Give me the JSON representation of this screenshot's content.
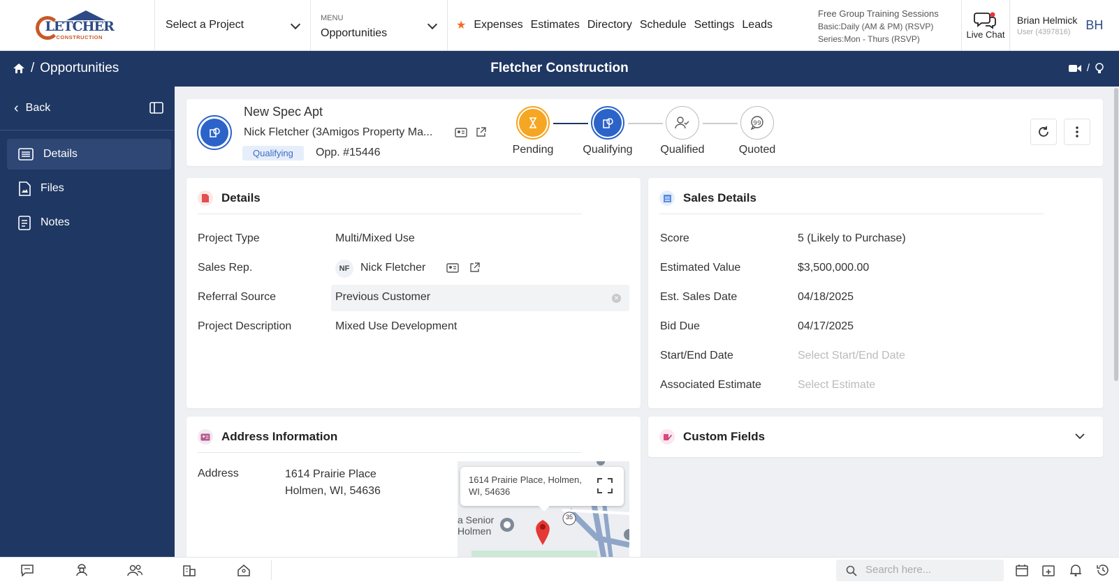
{
  "topbar": {
    "logo_main": "LETCHER",
    "logo_sub": "CONSTRUCTION",
    "project_select": "Select a Project",
    "menu_label": "MENU",
    "menu_value": "Opportunities",
    "nav": [
      "Expenses",
      "Estimates",
      "Directory",
      "Schedule",
      "Settings",
      "Leads"
    ],
    "training_title": "Free Group Training Sessions",
    "training_line1": "Basic:Daily (AM & PM) (RSVP)",
    "training_line2": "Series:Mon - Thurs (RSVP)",
    "live_chat": "Live Chat",
    "user_name": "Brian Helmick",
    "user_sub": "User (4397816)",
    "user_initials": "BH"
  },
  "titlebar": {
    "separator": "/",
    "breadcrumb": "Opportunities",
    "company": "Fletcher Construction"
  },
  "sidebar": {
    "back": "Back",
    "items": [
      {
        "label": "Details"
      },
      {
        "label": "Files"
      },
      {
        "label": "Notes"
      }
    ]
  },
  "header": {
    "title": "New Spec Apt",
    "contact": "Nick Fletcher (3Amigos Property Ma...",
    "status_badge": "Qualifying",
    "opp_number": "Opp. #15446",
    "stages": [
      "Pending",
      "Qualifying",
      "Qualified",
      "Quoted"
    ]
  },
  "details": {
    "title": "Details",
    "project_type_label": "Project Type",
    "project_type": "Multi/Mixed Use",
    "sales_rep_label": "Sales Rep.",
    "sales_rep_initials": "NF",
    "sales_rep": "Nick Fletcher",
    "referral_label": "Referral Source",
    "referral": "Previous Customer",
    "description_label": "Project Description",
    "description": "Mixed Use Development"
  },
  "sales": {
    "title": "Sales Details",
    "score_label": "Score",
    "score": "5 (Likely to Purchase)",
    "value_label": "Estimated Value",
    "value": "$3,500,000.00",
    "sales_date_label": "Est. Sales Date",
    "sales_date": "04/18/2025",
    "bid_due_label": "Bid Due",
    "bid_due": "04/17/2025",
    "start_end_label": "Start/End Date",
    "start_end_placeholder": "Select Start/End Date",
    "estimate_label": "Associated Estimate",
    "estimate_placeholder": "Select Estimate"
  },
  "address": {
    "title": "Address Information",
    "label": "Address",
    "line1": "1614 Prairie Place",
    "line2": "Holmen, WI, 54636",
    "map_popup": "1614 Prairie Place, Holmen, WI, 54636",
    "map_place_1": "a Senior",
    "map_place_2": "Holmen",
    "map_route": "35"
  },
  "custom": {
    "title": "Custom Fields"
  },
  "bottombar": {
    "search_placeholder": "Search here..."
  },
  "colors": {
    "navy": "#1f3763",
    "accent_blue": "#2b63c9",
    "pending_orange": "#f5a623"
  }
}
